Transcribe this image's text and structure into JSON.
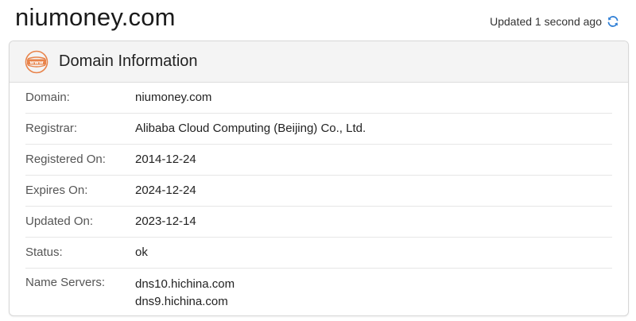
{
  "header": {
    "domain": "niumoney.com",
    "updated_text": "Updated 1 second ago",
    "refresh_icon": "refresh-icon"
  },
  "card": {
    "title": "Domain Information",
    "icon": "www-icon",
    "accent_color": "#e8834a",
    "rows": [
      {
        "label": "Domain:",
        "value": "niumoney.com"
      },
      {
        "label": "Registrar:",
        "value": "Alibaba Cloud Computing (Beijing) Co., Ltd."
      },
      {
        "label": "Registered On:",
        "value": "2014-12-24"
      },
      {
        "label": "Expires On:",
        "value": "2024-12-24"
      },
      {
        "label": "Updated On:",
        "value": "2023-12-14"
      },
      {
        "label": "Status:",
        "value": "ok"
      }
    ],
    "name_servers": {
      "label": "Name Servers:",
      "values": [
        "dns10.hichina.com",
        "dns9.hichina.com"
      ]
    }
  }
}
